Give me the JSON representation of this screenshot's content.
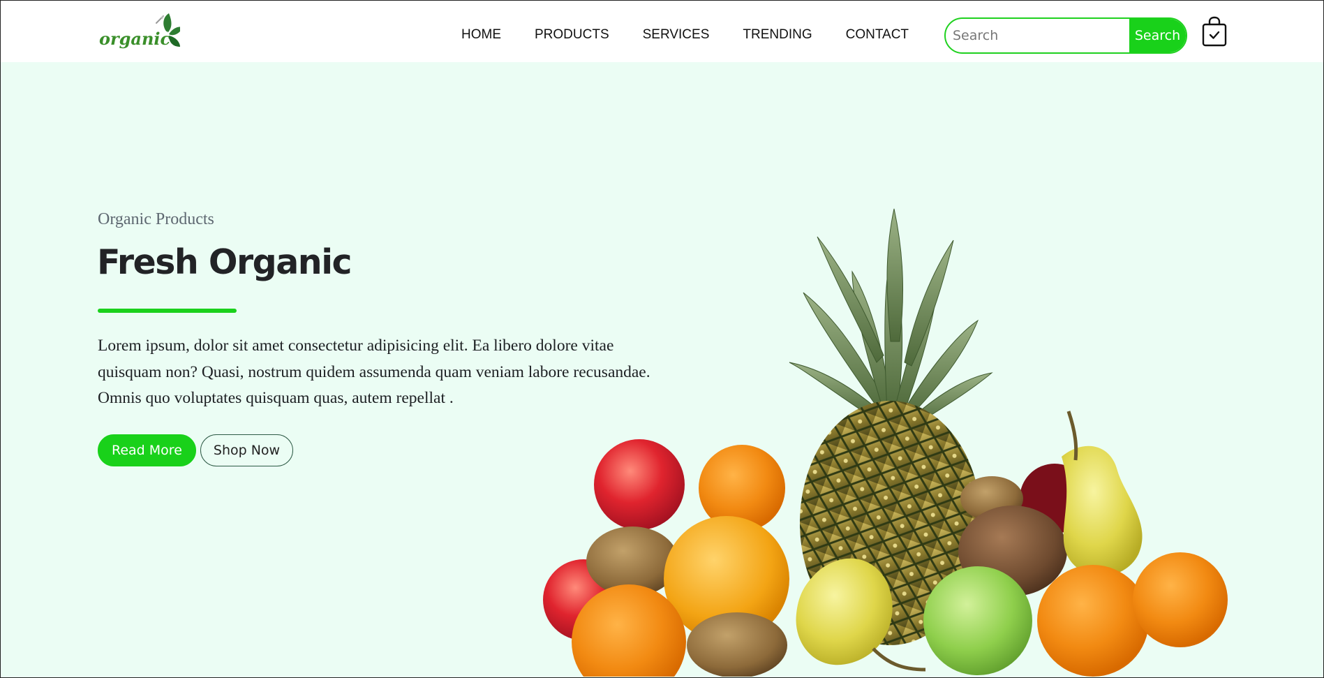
{
  "brand": {
    "logo_text": "organic"
  },
  "nav": {
    "links": [
      "HOME",
      "PRODUCTS",
      "SERVICES",
      "TRENDING",
      "CONTACT"
    ]
  },
  "search": {
    "placeholder": "Search",
    "value": "",
    "button_label": "Search"
  },
  "cart": {
    "icon": "shopping-bag-check-icon"
  },
  "hero": {
    "eyebrow": "Organic Products",
    "title": "Fresh Organic",
    "description": "Lorem ipsum, dolor sit amet consectetur adipisicing elit. Ea libero dolore vitae quisquam non? Quasi, nostrum quidem assumenda quam veniam labore recusandae. Omnis quo voluptates quisquam quas, autem repellat .",
    "primary_button": "Read More",
    "secondary_button": "Shop Now",
    "image": "fruit-assortment-image"
  },
  "colors": {
    "accent": "#19d11a",
    "hero_background": "#ebfdf4",
    "logo_green": "#3a8f2a",
    "heading": "#222326"
  }
}
